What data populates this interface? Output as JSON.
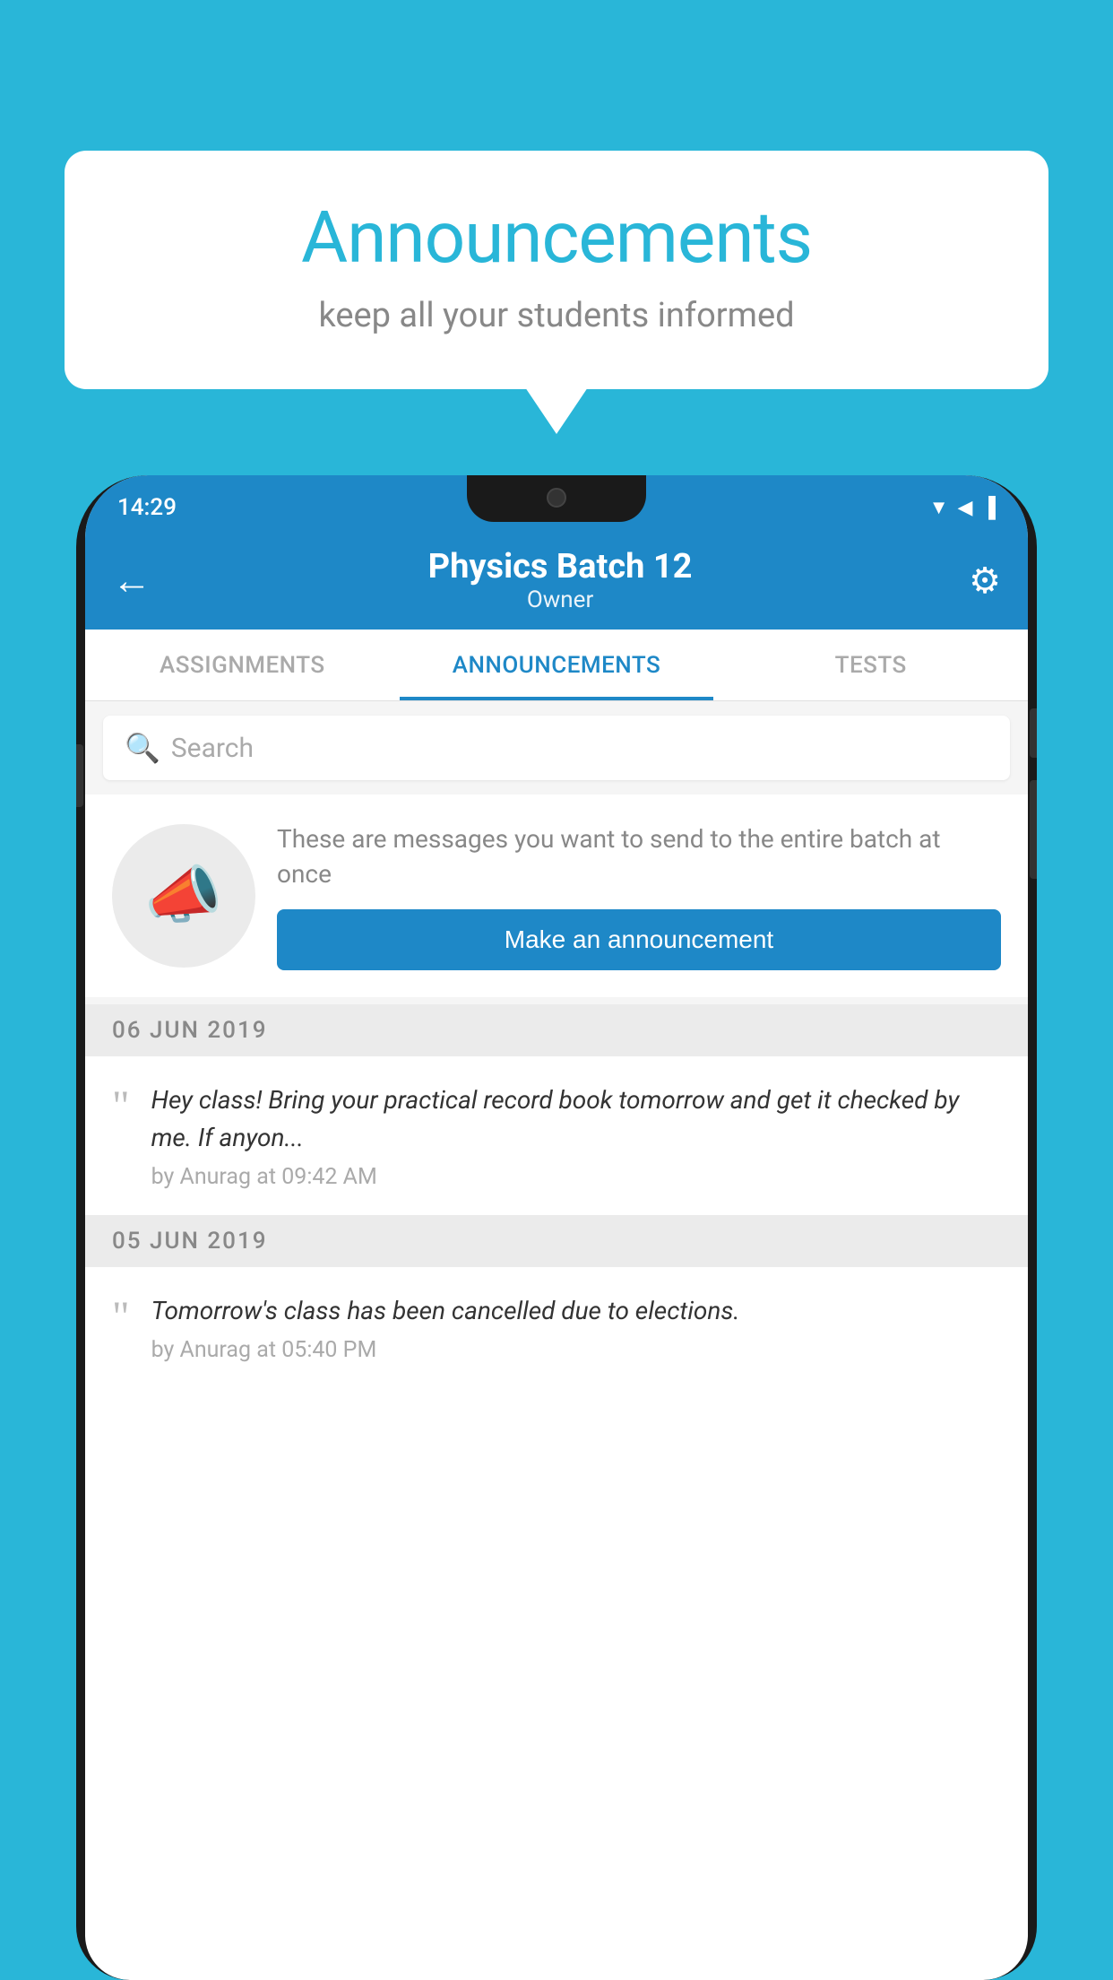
{
  "background_color": "#29b6d8",
  "speech_bubble": {
    "title": "Announcements",
    "subtitle": "keep all your students informed"
  },
  "phone": {
    "status_bar": {
      "time": "14:29",
      "wifi": "▼",
      "signal": "▲",
      "battery": "▐"
    },
    "header": {
      "back_label": "←",
      "title": "Physics Batch 12",
      "subtitle": "Owner",
      "settings_label": "⚙"
    },
    "tabs": [
      {
        "label": "ASSIGNMENTS",
        "active": false
      },
      {
        "label": "ANNOUNCEMENTS",
        "active": true
      },
      {
        "label": "TESTS",
        "active": false
      }
    ],
    "search": {
      "placeholder": "Search"
    },
    "promo": {
      "description": "These are messages you want to send to the entire batch at once",
      "button_label": "Make an announcement"
    },
    "date_dividers": [
      "06  JUN  2019",
      "05  JUN  2019"
    ],
    "announcements": [
      {
        "text": "Hey class! Bring your practical record book tomorrow and get it checked by me. If anyon...",
        "meta": "by Anurag at 09:42 AM",
        "date": "06  JUN  2019"
      },
      {
        "text": "Tomorrow's class has been cancelled due to elections.",
        "meta": "by Anurag at 05:40 PM",
        "date": "05  JUN  2019"
      }
    ]
  }
}
